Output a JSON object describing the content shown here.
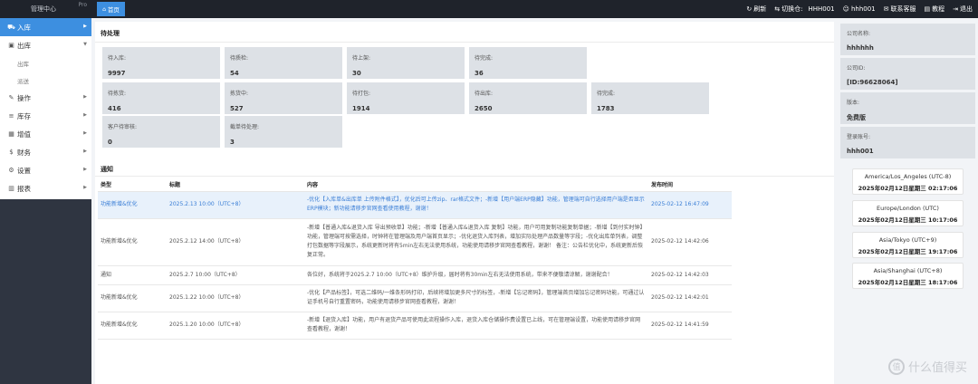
{
  "sidebar": {
    "title": "管理中心",
    "pro_badge": "Pro",
    "items": [
      {
        "label": "入库",
        "icon": "truck-icon",
        "active": true
      },
      {
        "label": "出库",
        "icon": "box-icon",
        "active": false
      },
      {
        "label": "操作",
        "icon": "edit-icon",
        "active": false
      },
      {
        "label": "库存",
        "icon": "database-icon",
        "active": false
      },
      {
        "label": "增值",
        "icon": "table-icon",
        "active": false
      },
      {
        "label": "财务",
        "icon": "dollar-icon",
        "active": false
      },
      {
        "label": "设置",
        "icon": "gear-icon",
        "active": false
      },
      {
        "label": "报表",
        "icon": "bar-chart-icon",
        "active": false
      }
    ],
    "sub_items": [
      "出库",
      "派送"
    ]
  },
  "topbar": {
    "home_tab": "首页",
    "refresh": "刷新",
    "switch_warehouse": "切换仓:",
    "warehouse": "HHH001",
    "user": "hhh001",
    "contact": "联系客服",
    "tutorial": "教程",
    "logout": "退出"
  },
  "pending": {
    "title": "待处理",
    "stats": [
      {
        "label": "待入库:",
        "value": "9997"
      },
      {
        "label": "待质检:",
        "value": "54"
      },
      {
        "label": "待上架:",
        "value": "30"
      },
      {
        "label": "待完成:",
        "value": "36"
      },
      {
        "label": "待拣货:",
        "value": "416"
      },
      {
        "label": "拣货中:",
        "value": "527"
      },
      {
        "label": "待打包:",
        "value": "1914"
      },
      {
        "label": "待出库:",
        "value": "2650"
      },
      {
        "label": "待完成:",
        "value": "1783"
      },
      {
        "label": "客户待审核:",
        "value": "0"
      },
      {
        "label": "截单待处理:",
        "value": "3"
      }
    ]
  },
  "notice": {
    "title": "通知",
    "headers": [
      "类型",
      "标题",
      "内容",
      "发布时间"
    ],
    "rows": [
      {
        "type": "功能新增&优化",
        "title": "2025.2.13 10:00（UTC+8）",
        "content": "-优化【入库单&出库单 上传附件格式】，优化后可上传zip、rar格式文件；-新增【用户端ERP隐藏】功能，管理端可自行选择用户端是否显示ERP模块；新功能请移步官网查看使用教程，谢谢！",
        "time": "2025-02-12 16:47:09",
        "highlight": true
      },
      {
        "type": "功能新增&优化",
        "title": "2025.2.12 14:00（UTC+8）",
        "content": "-新增【普通入库&退货入库 导出预收单】功能；-新增【普通入库&退货入库 复制】功能，用户可用复制功能复制单据；-新增【到付实时钟】功能，管理端可按需选择，时钟将在管理端及用户端首页显示；-优化退货入库列表，增加实际处理产品数量等字段；-优化出库单列表，调整打包数据等字段展示，系统更新时将有5min左右无法使用系统，功能使用请移步官网查看教程，谢谢！ 备注：公告栏优化中，系统更新后恢复正常。",
        "time": "2025-02-12 14:42:06",
        "highlight": false
      },
      {
        "type": "通知",
        "title": "2025.2.7 10:00（UTC+8）",
        "content": "各位好，系统将于2025.2.7 10:00（UTC+8）维护升级，届时将有30min左右无法使用系统，带来不便敬请谅解，谢谢配合！",
        "time": "2025-02-12 14:42:03",
        "highlight": false
      },
      {
        "type": "功能新增&优化",
        "title": "2025.1.22 10:00（UTC+8）",
        "content": "-优化【产品标签】，可选二维码/一维条形码打印，后续将增加更多尺寸的标签，-新增【忘记密码】，管理端首页增加忘记密码功能，可通过认证手机号自行重置密码，功能使用请移步官网查看教程，谢谢！",
        "time": "2025-02-12 14:42:01",
        "highlight": false
      },
      {
        "type": "功能新增&优化",
        "title": "2025.1.20 10:00（UTC+8）",
        "content": "-新增【退货入库】功能，用户有退货产品可使用此流程操作入库，退货入库仓储操作费设置已上线，可在管理端设置，功能使用请移步官网查看教程，谢谢！",
        "time": "2025-02-12 14:41:59",
        "highlight": false
      }
    ]
  },
  "company": [
    {
      "label": "公司名称:",
      "value": "hhhhhh"
    },
    {
      "label": "公司ID:",
      "value": "[ID:96628064]"
    },
    {
      "label": "版本:",
      "value": "免费版"
    },
    {
      "label": "登录账号:",
      "value": "hhh001"
    }
  ],
  "clocks": [
    {
      "tz": "America/Los_Angeles (UTC-8)",
      "datetime": "2025年02月12日星期三 02:17:06"
    },
    {
      "tz": "Europe/London (UTC)",
      "datetime": "2025年02月12日星期三 10:17:06"
    },
    {
      "tz": "Asia/Tokyo (UTC+9)",
      "datetime": "2025年02月12日星期三 19:17:06"
    },
    {
      "tz": "Asia/Shanghai (UTC+8)",
      "datetime": "2025年02月12日星期三 18:17:06"
    }
  ],
  "watermark": {
    "text": "什么值得买"
  }
}
